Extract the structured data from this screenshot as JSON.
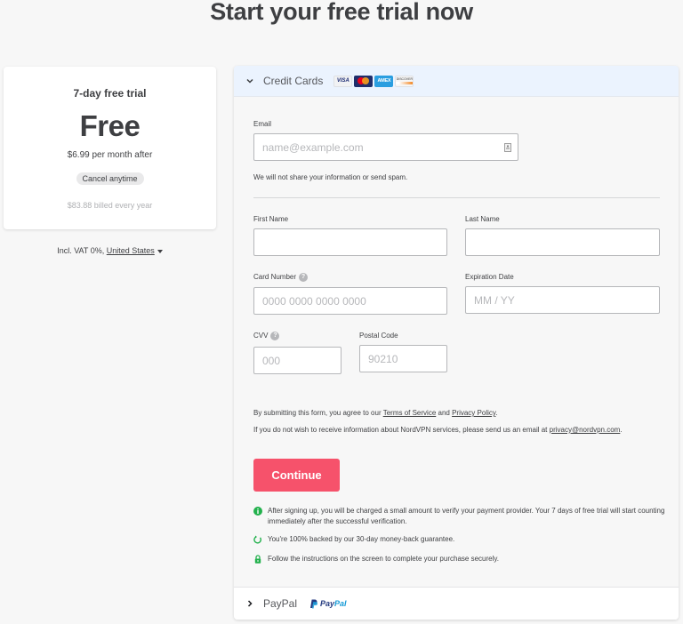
{
  "page": {
    "title": "Start your free trial now"
  },
  "plan": {
    "title": "7-day free trial",
    "price": "Free",
    "after": "$6.99 per month after",
    "badge": "Cancel anytime",
    "billed": "$83.88 billed every year"
  },
  "vat": {
    "prefix": "Incl. VAT 0%, ",
    "country": "United States"
  },
  "payment": {
    "credit_cards_label": "Credit Cards",
    "card_logos": [
      "VISA",
      "Mastercard",
      "AMEX",
      "DISCOVER"
    ],
    "paypal_label": "PayPal",
    "paypal_logo_a": "Pay",
    "paypal_logo_b": "Pal"
  },
  "form": {
    "email_label": "Email",
    "email_placeholder": "name@example.com",
    "email_note": "We will not share your information or send spam.",
    "first_name_label": "First Name",
    "first_name_value": "",
    "last_name_label": "Last Name",
    "last_name_value": "",
    "card_number_label": "Card Number",
    "card_number_placeholder": "0000 0000 0000 0000",
    "expiration_label": "Expiration Date",
    "expiration_placeholder": "MM / YY",
    "cvv_label": "CVV",
    "cvv_placeholder": "000",
    "postal_label": "Postal Code",
    "postal_placeholder": "90210",
    "help_glyph": "?"
  },
  "legal": {
    "agree_prefix": "By submitting this form, you agree to our ",
    "terms": "Terms of Service",
    "and": " and ",
    "privacy": "Privacy Policy",
    "period": ".",
    "optout_text": "If you do not wish to receive information about NordVPN services, please send us an email at ",
    "optout_email": "privacy@nordvpn.com"
  },
  "continue_label": "Continue",
  "info": [
    {
      "icon": "info-icon",
      "text": "After signing up, you will be charged a small amount to verify your payment provider. Your 7 days of free trial will start counting immediately after the successful verification."
    },
    {
      "icon": "refresh-icon",
      "text": "You're 100% backed by our 30-day money-back guarantee."
    },
    {
      "icon": "lock-icon",
      "text": "Follow the instructions on the screen to complete your purchase securely."
    }
  ],
  "colors": {
    "accent": "#f6526b",
    "success": "#23b14d",
    "header_bg": "#ebf3fe"
  }
}
